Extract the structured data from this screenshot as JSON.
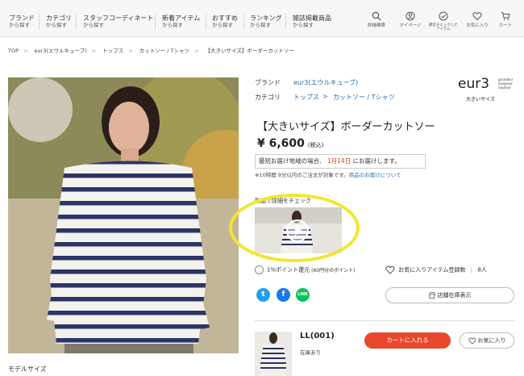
{
  "nav": {
    "items": [
      {
        "label": "ブランド",
        "sub": "から探す"
      },
      {
        "label": "カテゴリ",
        "sub": "から探す"
      },
      {
        "label": "スタッフコーディネート",
        "sub": "から探す"
      },
      {
        "label": "新着アイテム",
        "sub": "から探す"
      },
      {
        "label": "おすすめ",
        "sub": "から探す"
      },
      {
        "label": "ランキング",
        "sub": "から探す"
      },
      {
        "label": "雑誌掲載商品",
        "sub": "から探す"
      }
    ],
    "icons": [
      {
        "label": "詳細検索",
        "icon": "search-icon"
      },
      {
        "label": "マイページ",
        "icon": "user-icon"
      },
      {
        "label": "最近チェックしたアイテム",
        "icon": "check-circle-icon"
      },
      {
        "label": "お気に入り",
        "icon": "heart-icon"
      },
      {
        "label": "カート",
        "icon": "cart-icon"
      }
    ]
  },
  "breadcrumb": [
    "TOP",
    "eur3(エウルキューブ)",
    "トップス",
    "カットソー / Tシャツ",
    "【大きいサイズ】ボーダーカットソー"
  ],
  "product": {
    "brand_label": "ブランド",
    "brand": "eur3(エウルキューブ)",
    "category_label": "カテゴリ",
    "category_1": "トップス",
    "category_sep": ">",
    "category_2": "カットソー / Tシャツ",
    "title": "【大きいサイズ】ボーダーカットソー",
    "price": "¥ 6,600",
    "tax": "(税込)",
    "delivery_pre": "最短お届け地域の場合、",
    "delivery_date": "1月14日",
    "delivery_post": "にお届けします。",
    "note_pre": "※10時間 9分以内のご注文が対象です。",
    "note_link": "商品のお届けについて",
    "video_label": "動画で詳細をチェック",
    "points": "1%ポイント還元",
    "points_detail": "(60円分のポイント)",
    "fav_label": "お気に入りアイテム登録数",
    "fav_count": "8人",
    "store_button": "店舗在庫表示",
    "model_size": "モデルサイズ"
  },
  "logo": {
    "main": "eur3",
    "lines": [
      "grandeur",
      "longueur",
      "hauteur"
    ],
    "sub": "大きいサイズ"
  },
  "sku": {
    "name": "LL(001)",
    "stock": "在庫あり",
    "cart_button": "カートに入れる",
    "fav_button": "お気に入り"
  },
  "colors": {
    "accent": "#e8482c",
    "link": "#2b6aa8",
    "highlight": "#f2e62f",
    "twitter": "#1da1f2",
    "facebook": "#1877f2",
    "line": "#06c755"
  }
}
